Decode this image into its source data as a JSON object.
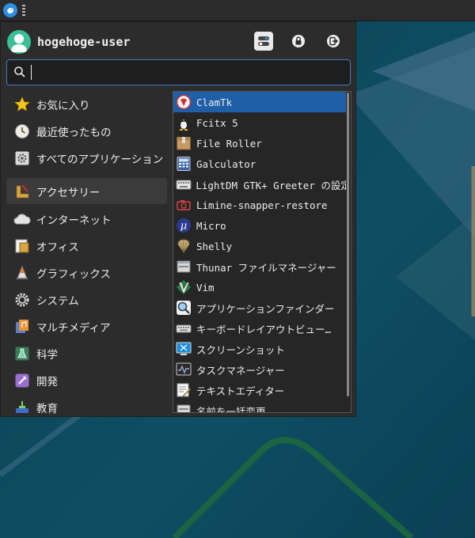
{
  "user": {
    "name": "hogehoge-user"
  },
  "header_actions": [
    {
      "name": "settings-toggle-icon"
    },
    {
      "name": "lock-icon"
    },
    {
      "name": "logout-icon"
    }
  ],
  "search": {
    "value": "",
    "placeholder": ""
  },
  "categories": [
    {
      "label": "お気に入り",
      "icon": "star-icon"
    },
    {
      "label": "最近使ったもの",
      "icon": "clock-icon"
    },
    {
      "label": "すべてのアプリケーション",
      "icon": "gear-icon"
    },
    {
      "label": "アクセサリー",
      "icon": "accessories-icon"
    },
    {
      "label": "インターネット",
      "icon": "cloud-icon"
    },
    {
      "label": "オフィス",
      "icon": "office-icon"
    },
    {
      "label": "グラフィックス",
      "icon": "graphics-icon"
    },
    {
      "label": "システム",
      "icon": "system-gear-icon"
    },
    {
      "label": "マルチメディア",
      "icon": "multimedia-icon"
    },
    {
      "label": "科学",
      "icon": "science-flask-icon"
    },
    {
      "label": "開発",
      "icon": "development-icon"
    },
    {
      "label": "教育",
      "icon": "education-icon"
    }
  ],
  "selected_category": "アクセサリー",
  "apps": [
    {
      "label": "ClamTk",
      "icon": "clamtk-icon"
    },
    {
      "label": "Fcitx 5",
      "icon": "penguin-icon"
    },
    {
      "label": "File Roller",
      "icon": "archive-icon"
    },
    {
      "label": "Galculator",
      "icon": "calculator-icon"
    },
    {
      "label": "LightDM GTK+ Greeter の設定",
      "icon": "keyboard-settings-icon"
    },
    {
      "label": "Limine-snapper-restore",
      "icon": "restore-icon"
    },
    {
      "label": "Micro",
      "icon": "micro-icon"
    },
    {
      "label": "Shelly",
      "icon": "shell-icon"
    },
    {
      "label": "Thunar ファイルマネージャー",
      "icon": "file-manager-icon"
    },
    {
      "label": "Vim",
      "icon": "vim-icon"
    },
    {
      "label": "アプリケーションファインダー",
      "icon": "magnifier-icon"
    },
    {
      "label": "キーボードレイアウトビュー…",
      "icon": "keyboard-icon"
    },
    {
      "label": "スクリーンショット",
      "icon": "screenshot-icon"
    },
    {
      "label": "タスクマネージャー",
      "icon": "task-manager-icon"
    },
    {
      "label": "テキストエディター",
      "icon": "text-editor-icon"
    },
    {
      "label": "名前を一括変更",
      "icon": "rename-icon"
    }
  ],
  "selected_app": "ClamTk",
  "colors": {
    "accent": "#1f5fa8",
    "panel": "#2c2c2c",
    "desktop": "#0d4a5c"
  }
}
